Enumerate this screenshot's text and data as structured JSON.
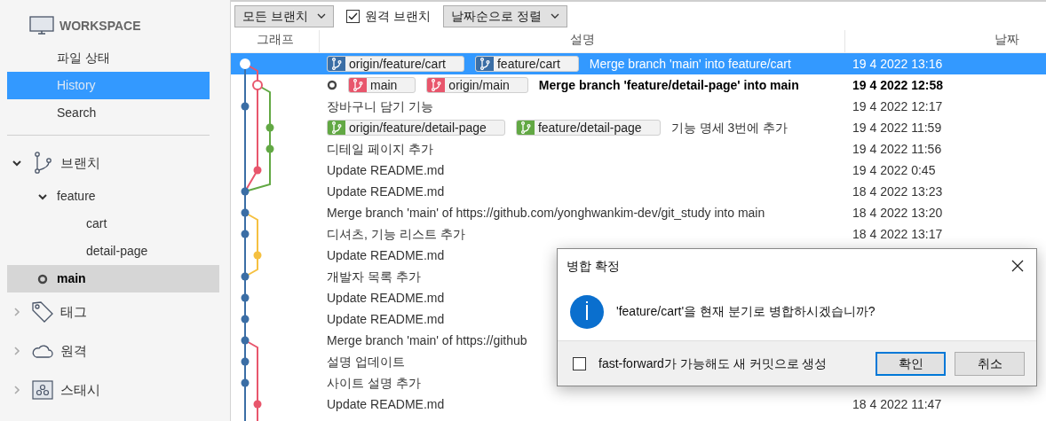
{
  "sidebar": {
    "workspace": {
      "title": "WORKSPACE",
      "items": [
        {
          "label": "파일 상태",
          "selected": false
        },
        {
          "label": "History",
          "selected": true
        },
        {
          "label": "Search",
          "selected": false
        }
      ]
    },
    "groups": [
      {
        "kind": "branches",
        "label": "브랜치",
        "expanded": true,
        "children": [
          {
            "label": "feature",
            "expanded": true,
            "selected": false,
            "children": [
              {
                "label": "cart",
                "selected": false
              },
              {
                "label": "detail-page",
                "selected": false
              }
            ]
          },
          {
            "label": "main",
            "selected": true,
            "current": true
          }
        ]
      },
      {
        "kind": "tags",
        "label": "태그",
        "expanded": false
      },
      {
        "kind": "remotes",
        "label": "원격",
        "expanded": false
      },
      {
        "kind": "stashes",
        "label": "스태시",
        "expanded": false
      }
    ]
  },
  "toolbar": {
    "branch_filter": "모든 브랜치",
    "remote_branches": {
      "label": "원격 브랜치",
      "checked": true
    },
    "sort": "날짜순으로 정렬"
  },
  "table": {
    "columns": [
      "그래프",
      "설명",
      "날짜"
    ],
    "rows": [
      {
        "refs": [
          {
            "name": "origin/feature/cart",
            "color": "#3b6ea5"
          },
          {
            "name": "feature/cart",
            "color": "#3b6ea5"
          }
        ],
        "description": "Merge branch 'main' into feature/cart",
        "date": "19 4 2022 13:16",
        "selected": true,
        "head": false
      },
      {
        "refs": [
          {
            "name": "main",
            "color": "#e8566c"
          },
          {
            "name": "origin/main",
            "color": "#e8566c"
          }
        ],
        "description": "Merge branch 'feature/detail-page' into main",
        "date": "19 4 2022 12:58",
        "selected": false,
        "head": true
      },
      {
        "description": "장바구니 담기 기능",
        "date": "19 4 2022 12:17",
        "selected": false,
        "head": false
      },
      {
        "refs": [
          {
            "name": "origin/feature/detail-page",
            "color": "#62a844"
          },
          {
            "name": "feature/detail-page",
            "color": "#62a844"
          }
        ],
        "description": "기능 명세 3번에 추가",
        "date": "19 4 2022 11:59",
        "selected": false,
        "head": false
      },
      {
        "description": "디테일 페이지 추가",
        "date": "19 4 2022 11:56",
        "selected": false,
        "head": false
      },
      {
        "description": "Update README.md",
        "date": "19 4 2022 0:45",
        "selected": false,
        "head": false
      },
      {
        "description": "Update README.md",
        "date": "18 4 2022 13:23",
        "selected": false,
        "head": false
      },
      {
        "description": "Merge branch 'main' of https://github.com/yonghwankim-dev/git_study into main",
        "date": "18 4 2022 13:20",
        "selected": false,
        "head": false
      },
      {
        "description": "디셔츠, 기능 리스트 추가",
        "date": "18 4 2022 13:17",
        "selected": false,
        "head": false
      },
      {
        "description": "Update README.md",
        "selected": false,
        "head": false
      },
      {
        "description": "개발자 목록 추가",
        "selected": false,
        "head": false
      },
      {
        "description": "Update README.md",
        "selected": false,
        "head": false
      },
      {
        "description": "Update README.md",
        "selected": false,
        "head": false
      },
      {
        "description": "Merge branch 'main' of https://github",
        "selected": false,
        "head": false
      },
      {
        "description": "설명 업데이트",
        "selected": false,
        "head": false
      },
      {
        "description": "사이트 설명 추가",
        "selected": false,
        "head": false
      },
      {
        "description": "Update README.md",
        "date": "18 4 2022 11:47",
        "selected": false,
        "head": false
      }
    ]
  },
  "dialog": {
    "title": "병합 확정",
    "message": "'feature/cart'을 현재 분기로 병합하시겠습니까?",
    "option": {
      "label": "fast-forward가 가능해도 새 커밋으로 생성",
      "checked": false
    },
    "buttons": [
      {
        "label": "확인",
        "focused": true
      },
      {
        "label": "취소",
        "focused": false
      }
    ]
  }
}
